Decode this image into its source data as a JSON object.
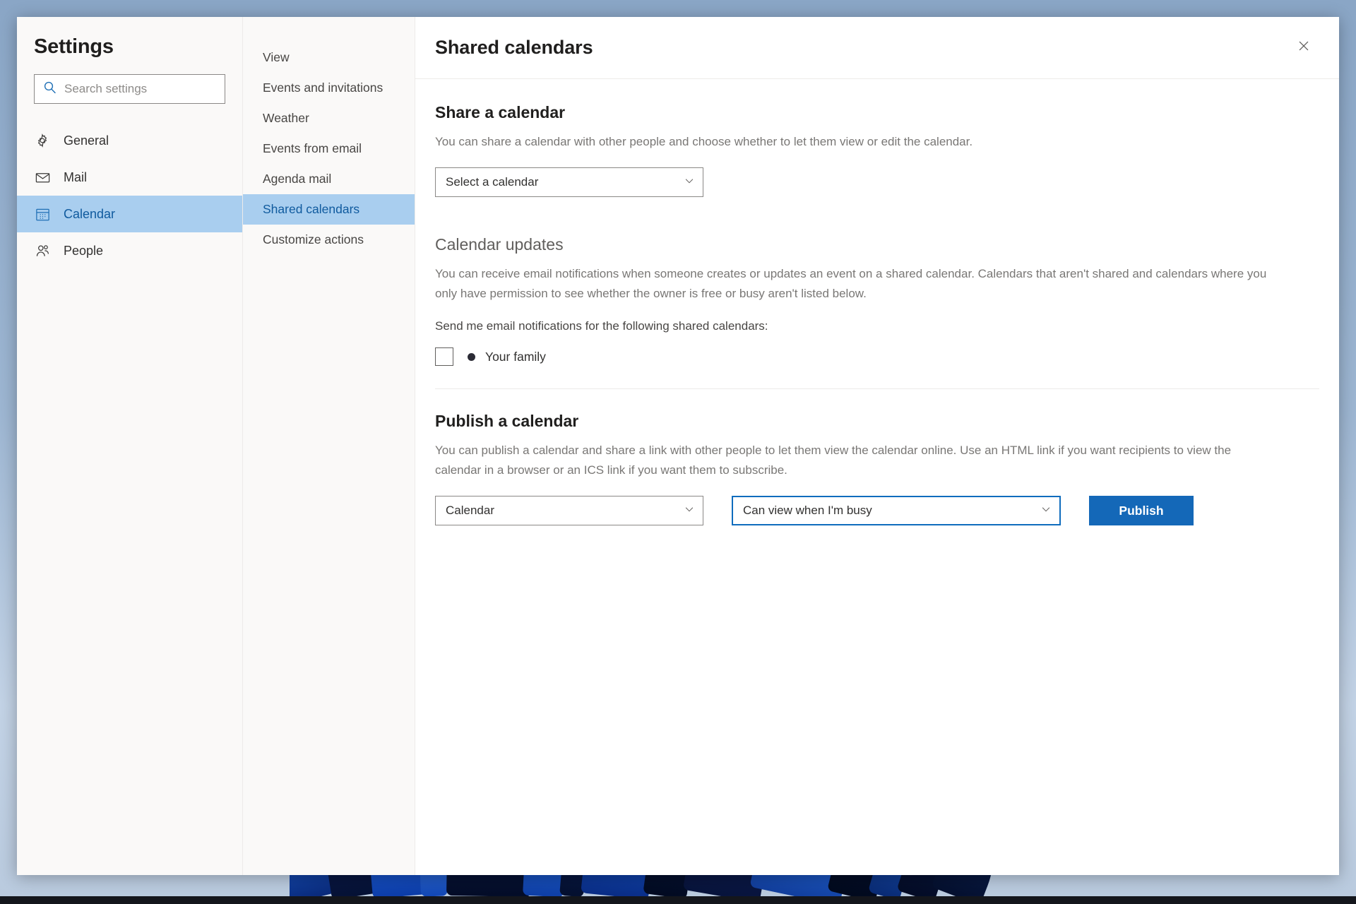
{
  "dialog": {
    "sidebar": {
      "title": "Settings",
      "search": {
        "placeholder": "Search settings",
        "value": "",
        "icon": "search-icon"
      },
      "items": [
        {
          "label": "General",
          "icon": "gear-icon",
          "selected": false
        },
        {
          "label": "Mail",
          "icon": "envelope-icon",
          "selected": false
        },
        {
          "label": "Calendar",
          "icon": "calendar-icon",
          "selected": true
        },
        {
          "label": "People",
          "icon": "people-icon",
          "selected": false
        }
      ]
    },
    "subnav": {
      "items": [
        {
          "label": "View",
          "selected": false
        },
        {
          "label": "Events and invitations",
          "selected": false
        },
        {
          "label": "Weather",
          "selected": false
        },
        {
          "label": "Events from email",
          "selected": false
        },
        {
          "label": "Agenda mail",
          "selected": false
        },
        {
          "label": "Shared calendars",
          "selected": true
        },
        {
          "label": "Customize actions",
          "selected": false
        }
      ]
    },
    "header": {
      "title": "Shared calendars",
      "close_icon": "close-icon"
    },
    "share_section": {
      "title": "Share a calendar",
      "description": "You can share a calendar with other people and choose whether to let them view or edit the calendar.",
      "calendar_select": {
        "value": "Select a calendar",
        "chevron_icon": "chevron-down-icon"
      }
    },
    "updates_section": {
      "title": "Calendar updates",
      "description": "You can receive email notifications when someone creates or updates an event on a shared calendar. Calendars that aren't shared and calendars where you only have permission to see whether the owner is free or busy aren't listed below.",
      "notify_label": "Send me email notifications for the following shared calendars:",
      "calendars": [
        {
          "name": "Your family",
          "checked": false,
          "color": "#2b2b35"
        }
      ]
    },
    "publish_section": {
      "title": "Publish a calendar",
      "description": "You can publish a calendar and share a link with other people to let them view the calendar online. Use an HTML link if you want recipients to view the calendar in a browser or an ICS link if you want them to subscribe.",
      "calendar_select": {
        "value": "Calendar",
        "chevron_icon": "chevron-down-icon"
      },
      "permission_select": {
        "value": "Can view when I'm busy",
        "chevron_icon": "chevron-down-icon",
        "focused": true
      },
      "publish_button": "Publish"
    },
    "colors": {
      "accent": "#1468b8",
      "selection": "#a9ceef",
      "selected_text": "#0f5a9e",
      "sidebar_bg": "#faf9f8",
      "body_text": "#797775"
    }
  }
}
